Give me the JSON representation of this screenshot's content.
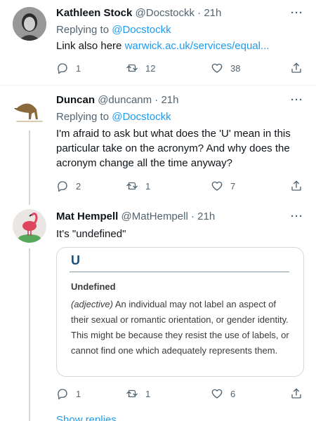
{
  "tweets": [
    {
      "name": "Kathleen Stock",
      "handle": "@Docstockk",
      "dot": "·",
      "time": "21h",
      "more": "···",
      "replying_prefix": "Replying to ",
      "replying_to": "@Docstockk",
      "text_prefix": "Link also here ",
      "text_link": "warwick.ac.uk/services/equal...",
      "replies": "1",
      "retweets": "12",
      "likes": "38"
    },
    {
      "name": "Duncan",
      "handle": "@duncanm",
      "dot": "·",
      "time": "21h",
      "more": "···",
      "replying_prefix": "Replying to ",
      "replying_to": "@Docstockk",
      "text": "I'm afraid to ask but what does the 'U' mean in this particular take on the acronym? And why does the acronym change all the time anyway?",
      "replies": "2",
      "retweets": "1",
      "likes": "7"
    },
    {
      "name": "Mat Hempell",
      "handle": "@MatHempell",
      "dot": "·",
      "time": "21h",
      "more": "···",
      "text": "It's \"undefined\"",
      "card": {
        "letter": "U",
        "term": "Undefined",
        "pos": "(adjective)",
        "definition": " An individual may not label an aspect of their sexual or romantic orientation, or gender identity. This might be because they resist the use of labels, or cannot find one which adequately represents them."
      },
      "replies": "1",
      "retweets": "1",
      "likes": "6"
    }
  ],
  "show_replies": "Show replies",
  "colors": {
    "link": "#1d9bf0",
    "secondary_text": "#536471",
    "divider": "#eff3f4",
    "thread_line": "#cfd9de"
  },
  "icons": {
    "reply": "reply-icon",
    "retweet": "retweet-icon",
    "like": "like-icon",
    "share": "share-icon",
    "more": "more-icon"
  }
}
